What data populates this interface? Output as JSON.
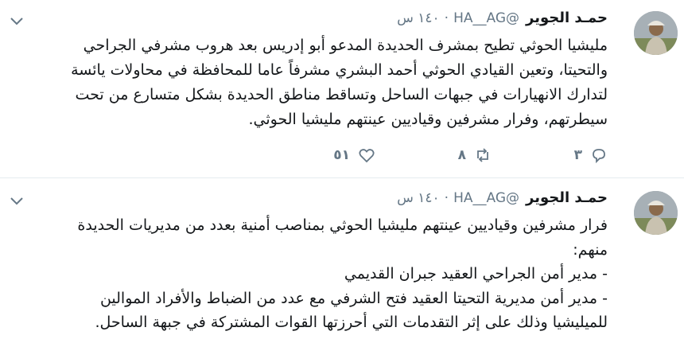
{
  "tweets": [
    {
      "name": "حمـد الجوير",
      "handle": "@HA__AG",
      "time": "١٤٠ س",
      "text": "مليشيا الحوثي تطيح بمشرف الحديدة المدعو أبو إدريس بعد هروب مشرفي الجراحي\nوالتحيتا، وتعين القيادي الحوثي أحمد البشري مشرفاً عاما للمحافظة في محاولات يائسة\nلتدارك الانهيارات في جبهات الساحل وتساقط مناطق الحديدة بشكل متسارع من تحت\nسيطرتهم، وفرار مشرفين وقياديين عينتهم مليشيا الحوثي.",
      "reply_count": "٣",
      "retweet_count": "٨",
      "like_count": "٥١"
    },
    {
      "name": "حمـد الجوير",
      "handle": "@HA__AG",
      "time": "١٤٠ س",
      "text": "فرار مشرفين وقياديين عينتهم مليشيا الحوثي بمناصب أمنية بعدد من مديريات الحديدة\nمنهم:\n- مدير أمن الجراحي العقيد جبران القديمي\n- مدير أمن مديرية التحيتا العقيد فتح الشرفي مع عدد من الضباط والأفراد الموالين\nللميليشيا وذلك على إثر التقدمات التي أحرزتها القوات المشتركة في جبهة الساحل."
    }
  ],
  "icons": {
    "menu": "chevron-down-icon",
    "reply": "reply-icon",
    "retweet": "retweet-icon",
    "like": "heart-icon"
  },
  "colors": {
    "text": "#14171a",
    "muted": "#657786",
    "divider": "#e6ecf0"
  }
}
